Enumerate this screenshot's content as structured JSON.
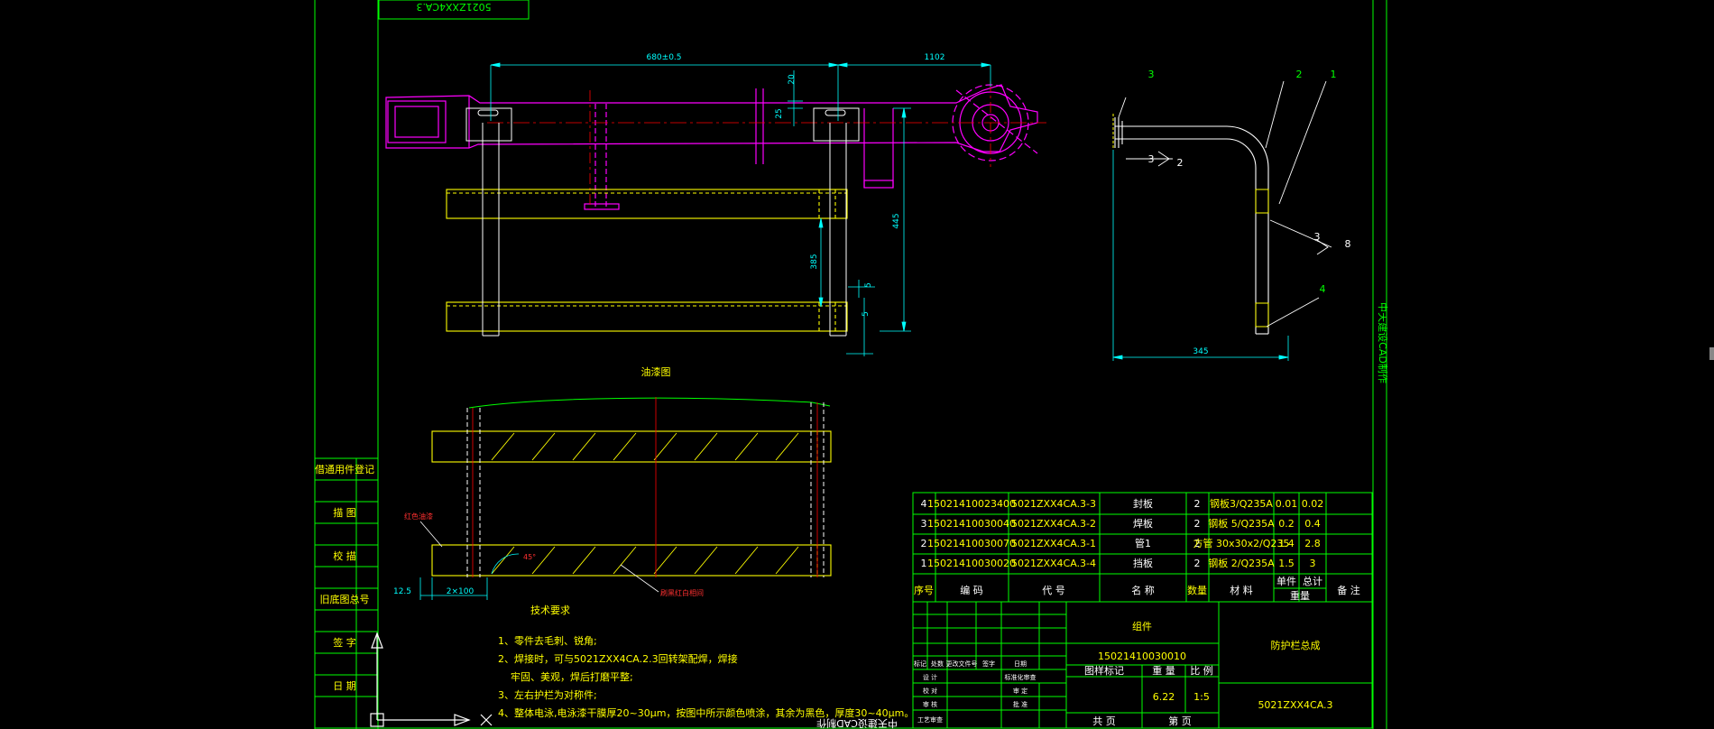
{
  "title_block": {
    "stamp_top": "5021ZXX4CA.3",
    "category": "组件",
    "drawing_code": "15021410030010",
    "drawing_name": "防护栏总成",
    "drawing_number": "5021ZXX4CA.3",
    "weight": "6.22",
    "scale": "1:5",
    "stage_mark": "图样标记",
    "weight_label": "重 量",
    "scale_label": "比 例",
    "sheets_total": "共 页",
    "sheet_no": "第 页",
    "side_label": "中天建设CAD制作",
    "bottom_label": "中天建设CAD制作"
  },
  "left_column": [
    "借通用件登记",
    "描 图",
    "校 描",
    "旧底图总号",
    "签 字",
    "日 期"
  ],
  "revision_rows": [
    "标记",
    "处数",
    "更改文件号",
    "签字",
    "日期",
    "设 计",
    "校 对",
    "审 核",
    "工艺审查",
    "标准化审查",
    "审 定",
    "批 准"
  ],
  "bom_header": [
    "序号",
    "编 码",
    "代 号",
    "名 称",
    "数量",
    "材 料",
    "单件",
    "总计",
    "备 注"
  ],
  "bom_header_weight": "重量",
  "bom_rows": [
    {
      "no": "4",
      "code": "15021410023400",
      "ref": "5021ZXX4CA.3-3",
      "name": "封板",
      "qty": "2",
      "mat": "钢板3/Q235A",
      "unit": "0.01",
      "total": "0.02"
    },
    {
      "no": "3",
      "code": "15021410030040",
      "ref": "5021ZXX4CA.3-2",
      "name": "焊板",
      "qty": "2",
      "mat": "钢板 5/Q235A",
      "unit": "0.2",
      "total": "0.4"
    },
    {
      "no": "2",
      "code": "15021410030070",
      "ref": "5021ZXX4CA.3-1",
      "name": "管1",
      "qty": "2",
      "mat": "方管 30x30x2/Q235",
      "unit": "1.4",
      "total": "2.8"
    },
    {
      "no": "1",
      "code": "15021410030020",
      "ref": "5021ZXX4CA.3-4",
      "name": "挡板",
      "qty": "2",
      "mat": "钢板 2/Q235A",
      "unit": "1.5",
      "total": "3"
    }
  ],
  "dimensions": {
    "d_680": "680±0.5",
    "d_1102": "1102",
    "d_20": "20",
    "d_25": "25",
    "d_445": "445",
    "d_385": "385",
    "d_5a": "5",
    "d_5b": "5",
    "d_345": "345",
    "d_125": "12.5",
    "d_2x100": "2×100",
    "d_45": "45°"
  },
  "labels": {
    "view_title": "油漆图",
    "red_note": "红色油漆",
    "hatch_note": "刷黑红白相间",
    "balloon_1": "1",
    "balloon_2": "2",
    "balloon_3": "3",
    "balloon_4": "4",
    "weld_3a": "3",
    "weld_2": "2",
    "weld_3b": "3",
    "weld_8": "8"
  },
  "tech": {
    "heading": "技术要求",
    "items": [
      "1、零件去毛刺、锐角;",
      "2、焊接时，可与5021ZXX4CA.2.3回转架配焊，焊接",
      "牢固、美观，焊后打磨平整;",
      "3、左右护栏为对称件;",
      "4、整体电泳,电泳漆干膜厚20~30μm，按图中所示颜色喷涂，其余为黑色，厚度30~40μm。"
    ]
  }
}
